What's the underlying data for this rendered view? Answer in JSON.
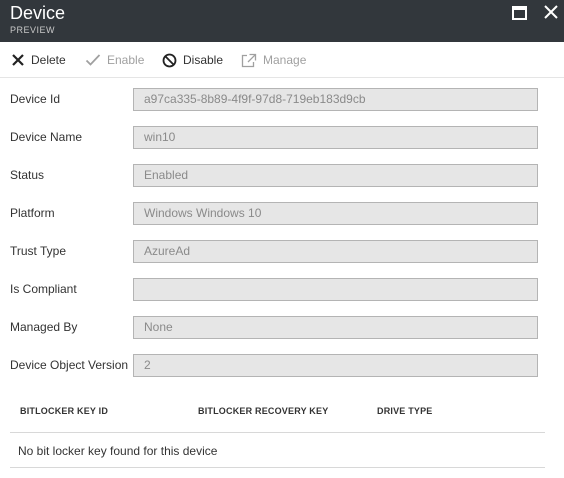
{
  "header": {
    "title": "Device",
    "subtitle": "PREVIEW"
  },
  "toolbar": {
    "delete_label": "Delete",
    "enable_label": "Enable",
    "disable_label": "Disable",
    "manage_label": "Manage"
  },
  "fields": [
    {
      "label": "Device Id",
      "value": "a97ca335-8b89-4f9f-97d8-719eb183d9cb"
    },
    {
      "label": "Device Name",
      "value": "win10"
    },
    {
      "label": "Status",
      "value": "Enabled"
    },
    {
      "label": "Platform",
      "value": "Windows Windows 10"
    },
    {
      "label": "Trust Type",
      "value": "AzureAd"
    },
    {
      "label": "Is Compliant",
      "value": ""
    },
    {
      "label": "Managed By",
      "value": "None"
    },
    {
      "label": "Device Object Version",
      "value": "2"
    }
  ],
  "bitlocker": {
    "columns": [
      "BITLOCKER KEY ID",
      "BITLOCKER RECOVERY KEY",
      "DRIVE TYPE"
    ],
    "empty_message": "No bit locker key found for this device"
  },
  "colors": {
    "header_bg": "#32373c",
    "field_bg": "#e6e6e6",
    "disabled_text": "#a0a0a0"
  }
}
